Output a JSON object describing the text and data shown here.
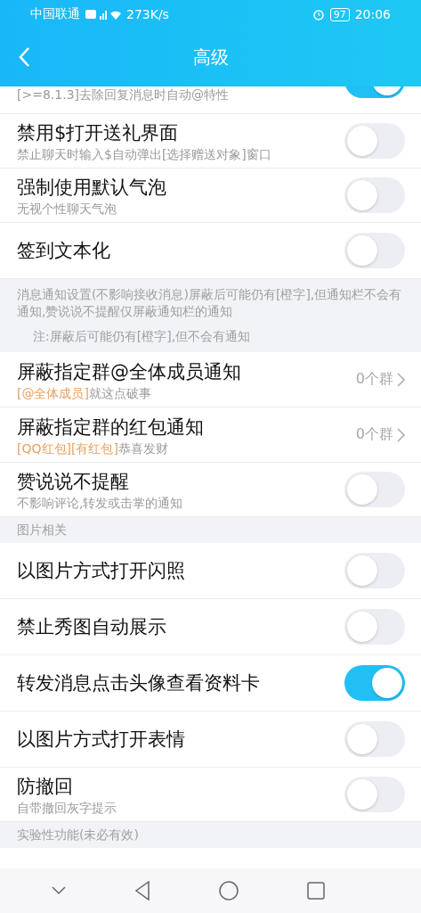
{
  "status_bar": {
    "carrier": "中国联通",
    "speed": "273K/s",
    "battery": "97",
    "time": "20:06"
  },
  "header": {
    "title": "高级"
  },
  "items": [
    {
      "kind": "partial",
      "subtitle": "[>=8.1.3]去除回复消息时自动@特性",
      "on": true
    },
    {
      "kind": "toggle",
      "title": "禁用$打开送礼界面",
      "subtitle": "禁止聊天时输入$自动弹出[选择赠送对象]窗口",
      "on": false
    },
    {
      "kind": "toggle",
      "title": "强制使用默认气泡",
      "subtitle": "无视个性聊天气泡",
      "on": false
    },
    {
      "kind": "toggle",
      "title": "签到文本化",
      "on": false
    },
    {
      "kind": "note",
      "text": "消息通知设置(不影响接收消息)屏蔽后可能仍有[橙字],但通知栏不会有通知,赞说说不提醒仅屏蔽通知栏的通知",
      "note": "注:屏蔽后可能仍有[橙字],但不会有通知"
    },
    {
      "kind": "link",
      "title": "屏蔽指定群@全体成员通知",
      "highlight": "[@全体成员]",
      "subtitle": "就这点破事",
      "value": "0个群"
    },
    {
      "kind": "link",
      "title": "屏蔽指定群的红包通知",
      "highlight": "[QQ红包][有红包]",
      "subtitle": "恭喜发财",
      "value": "0个群"
    },
    {
      "kind": "toggle",
      "title": "赞说说不提醒",
      "subtitle": "不影响评论,转发或击掌的通知",
      "on": false
    },
    {
      "kind": "section",
      "text": "图片相关"
    },
    {
      "kind": "toggle",
      "title": "以图片方式打开闪照",
      "on": false
    },
    {
      "kind": "toggle",
      "title": "禁止秀图自动展示",
      "on": false
    },
    {
      "kind": "toggle",
      "title": "转发消息点击头像查看资料卡",
      "on": true
    },
    {
      "kind": "toggle",
      "title": "以图片方式打开表情",
      "on": false
    },
    {
      "kind": "toggle",
      "title": "防撤回",
      "subtitle": "自带撤回灰字提示",
      "on": false
    },
    {
      "kind": "section",
      "text": "实验性功能(未必有效)"
    }
  ]
}
